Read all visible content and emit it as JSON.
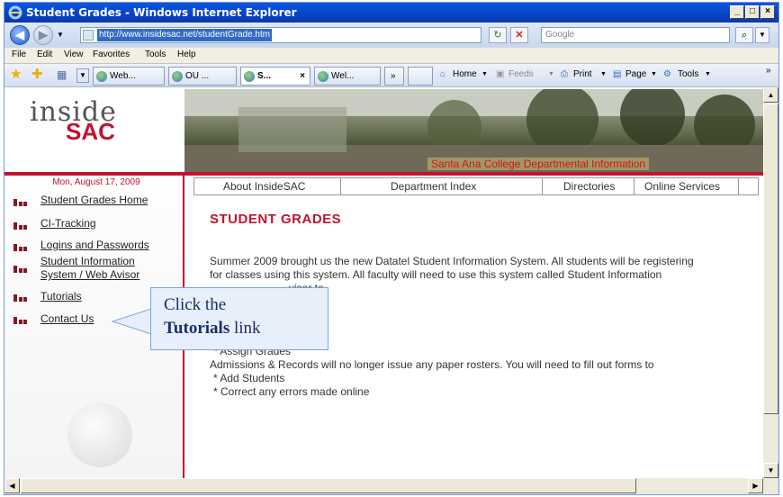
{
  "window": {
    "title": "Student Grades - Windows Internet Explorer",
    "min": "_",
    "max": "□",
    "close": "×"
  },
  "address": {
    "url": "http://www.insidesac.net/studentGrade.htm",
    "search_placeholder": "Google"
  },
  "menu": [
    "File",
    "Edit",
    "View",
    "Favorites",
    "Tools",
    "Help"
  ],
  "tabs": [
    {
      "label": "Web...",
      "active": false
    },
    {
      "label": "OU ...",
      "active": false
    },
    {
      "label": "S...",
      "active": true
    },
    {
      "label": "Wel...",
      "active": false
    }
  ],
  "tab_overflow": "»",
  "commands": {
    "home": "Home",
    "feeds": "Feeds",
    "print": "Print",
    "page": "Page",
    "tools": "Tools"
  },
  "page": {
    "logo_top": "inside",
    "logo_bottom": "SAC",
    "banner_caption": "Santa Ana College Departmental Information",
    "date": "Mon, August 17, 2009",
    "nav": [
      "Student Grades Home",
      "CI-Tracking",
      "Logins and Passwords",
      "Student Information",
      "System / Web Avisor",
      "Tutorials",
      "Contact Us"
    ],
    "top_tabs": [
      "About InsideSAC",
      "Department Index",
      "Directories",
      "Online Services"
    ],
    "heading": "STUDENT GRADES",
    "lines": [
      "Summer 2009 brought us the new Datatel Student Information System.  All students will be registering",
      "for classes using this system.  All faculty will need to use this system called Student Information",
      "visor to",
      "* Assign Grades",
      "Admissions & Records will no longer issue any paper rosters.  You will need to fill out forms to",
      "* Add Students",
      "* Correct any errors made online"
    ]
  },
  "callout": {
    "line1": "Click the",
    "line2_bold": "Tutorials",
    "line2_rest": "link"
  }
}
